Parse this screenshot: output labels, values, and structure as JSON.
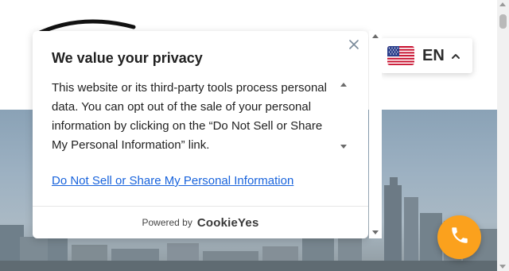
{
  "language_switcher": {
    "code": "EN",
    "flag_icon": "us-flag-icon",
    "chevron_icon": "chevron-up-icon"
  },
  "cookie_dialog": {
    "title": "We value your privacy",
    "description": "This website or its third-party tools process personal data. You can opt out of the sale of your personal information by clicking on the “Do Not Sell or Share My Personal Information” link.",
    "opt_out_link": "Do Not Sell or Share My Personal Information",
    "powered_by": "Powered by",
    "brand": "CookieYes",
    "close_icon": "close-icon"
  },
  "call_button": {
    "icon": "phone-icon",
    "color": "#fba11d"
  },
  "colors": {
    "link": "#1863dc",
    "accent": "#fba11d"
  }
}
